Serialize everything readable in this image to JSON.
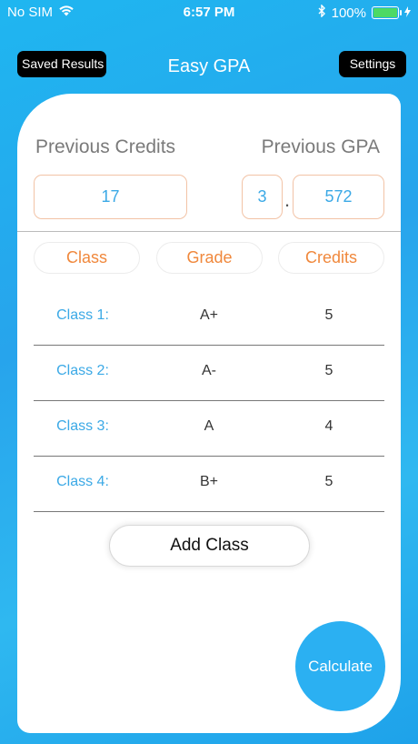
{
  "status": {
    "carrier": "No SIM",
    "time": "6:57 PM",
    "battery": "100%",
    "battery_level": 1.0
  },
  "nav": {
    "saved_label": "Saved Results",
    "title": "Easy GPA",
    "settings_label": "Settings"
  },
  "previous": {
    "credits_label": "Previous Credits",
    "gpa_label": "Previous GPA",
    "credits_value": "17",
    "gpa_int": "3",
    "gpa_sep": ".",
    "gpa_dec": "572"
  },
  "columns": {
    "class": "Class",
    "grade": "Grade",
    "credits": "Credits"
  },
  "classes": [
    {
      "name": "Class 1:",
      "grade": "A+",
      "credits": "5"
    },
    {
      "name": "Class 2:",
      "grade": "A-",
      "credits": "5"
    },
    {
      "name": "Class 3:",
      "grade": "A",
      "credits": "4"
    },
    {
      "name": "Class 4:",
      "grade": "B+",
      "credits": "5"
    }
  ],
  "actions": {
    "add_class": "Add Class",
    "calculate": "Calculate"
  },
  "colors": {
    "accent_blue": "#3ba9e6",
    "accent_orange": "#f0883c"
  }
}
